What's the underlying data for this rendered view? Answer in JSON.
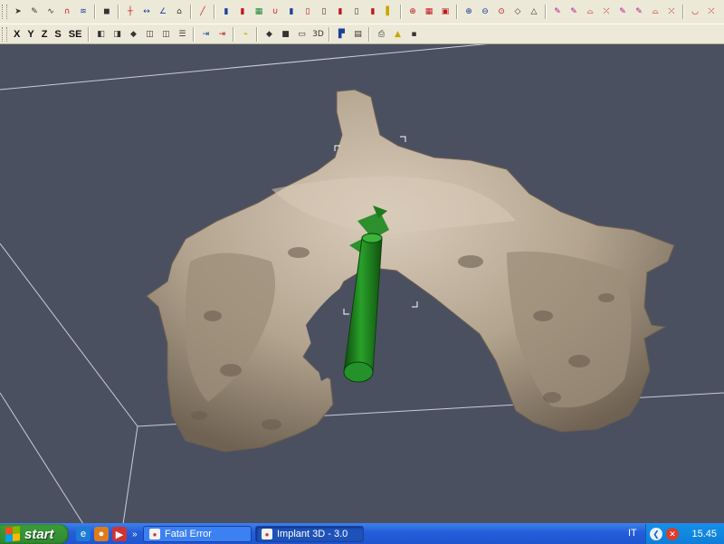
{
  "toolbar": {
    "row1": [
      {
        "name": "select-arrow-icon",
        "glyph": "➤",
        "cls": "c-dk"
      },
      {
        "name": "draw-pen-icon",
        "glyph": "✎",
        "cls": "c-dk"
      },
      {
        "name": "curve-icon",
        "glyph": "∿",
        "cls": "c-dk"
      },
      {
        "name": "arc-icon",
        "glyph": "∩",
        "cls": "c-red"
      },
      {
        "name": "spiral-icon",
        "glyph": "≋",
        "cls": "c-blue"
      },
      {
        "sep": true
      },
      {
        "name": "cube-view-icon",
        "glyph": "◼",
        "cls": "c-dk"
      },
      {
        "sep": true
      },
      {
        "name": "crosshair-icon",
        "glyph": "┼",
        "cls": "c-red"
      },
      {
        "name": "measure-distance-icon",
        "glyph": "↔",
        "cls": "c-blue"
      },
      {
        "name": "angle-icon",
        "glyph": "∠",
        "cls": "c-blue"
      },
      {
        "name": "house-section-icon",
        "glyph": "⌂",
        "cls": "c-dk"
      },
      {
        "sep": true
      },
      {
        "name": "wand-icon",
        "glyph": "╱",
        "cls": "c-red"
      },
      {
        "sep": true
      },
      {
        "name": "implant-add-icon",
        "glyph": "▮",
        "cls": "c-blue"
      },
      {
        "name": "implant-remove-icon",
        "glyph": "▮",
        "cls": "c-red"
      },
      {
        "name": "implant-group-icon",
        "glyph": "▦",
        "cls": "c-green"
      },
      {
        "name": "magnet-icon",
        "glyph": "∪",
        "cls": "c-red"
      },
      {
        "name": "implant-tilt-icon",
        "glyph": "▮",
        "cls": "c-blue"
      },
      {
        "name": "implant-a-icon",
        "glyph": "▯",
        "cls": "c-red"
      },
      {
        "name": "implant-b-icon",
        "glyph": "▯",
        "cls": "c-dk"
      },
      {
        "name": "implant-c-icon",
        "glyph": "▮",
        "cls": "c-red"
      },
      {
        "name": "implant-d-icon",
        "glyph": "▯",
        "cls": "c-dk"
      },
      {
        "name": "implant-e-icon",
        "glyph": "▮",
        "cls": "c-red"
      },
      {
        "name": "light-icon",
        "glyph": "▌",
        "cls": "c-yel"
      },
      {
        "sep": true
      },
      {
        "name": "view-target-icon",
        "glyph": "⊕",
        "cls": "c-red"
      },
      {
        "name": "view-grid-icon",
        "glyph": "▦",
        "cls": "c-red"
      },
      {
        "name": "view-box-icon",
        "glyph": "▣",
        "cls": "c-red"
      },
      {
        "sep": true
      },
      {
        "name": "zoom-in-icon",
        "glyph": "⊕",
        "cls": "c-blue"
      },
      {
        "name": "zoom-out-icon",
        "glyph": "⊖",
        "cls": "c-blue"
      },
      {
        "name": "zoom-fit-icon",
        "glyph": "⊙",
        "cls": "c-red"
      },
      {
        "name": "rotate-icon",
        "glyph": "◇",
        "cls": "c-dk"
      },
      {
        "name": "pan-icon",
        "glyph": "△",
        "cls": "c-dk"
      },
      {
        "sep": true
      },
      {
        "name": "show-mandible-icon",
        "glyph": "✎",
        "cls": "c-mag"
      },
      {
        "name": "show-maxilla-icon",
        "glyph": "✎",
        "cls": "c-mag"
      },
      {
        "name": "show-nerve-icon",
        "glyph": "⌓",
        "cls": "c-red"
      },
      {
        "name": "hide-nerve-icon",
        "glyph": "⤫",
        "cls": "c-red"
      },
      {
        "name": "show-teeth-icon",
        "glyph": "✎",
        "cls": "c-mag"
      },
      {
        "name": "show-guide-icon",
        "glyph": "✎",
        "cls": "c-mag"
      },
      {
        "name": "show-contour-icon",
        "glyph": "⌓",
        "cls": "c-red"
      },
      {
        "name": "hide-contour-icon",
        "glyph": "⤫",
        "cls": "c-red"
      },
      {
        "sep": true
      },
      {
        "name": "show-bone-icon",
        "glyph": "◡",
        "cls": "c-red"
      },
      {
        "name": "hide-bone-icon",
        "glyph": "⤫",
        "cls": "c-red"
      }
    ],
    "row2": [
      {
        "name": "axis-x-button",
        "text": "X"
      },
      {
        "name": "axis-y-button",
        "text": "Y"
      },
      {
        "name": "axis-z-button",
        "text": "Z"
      },
      {
        "name": "axis-s-button",
        "text": "S"
      },
      {
        "name": "axis-se-button",
        "text": "SE"
      },
      {
        "sep": true
      },
      {
        "name": "slice-a-icon",
        "glyph": "◧",
        "cls": "c-dk"
      },
      {
        "name": "slice-b-icon",
        "glyph": "◨",
        "cls": "c-dk"
      },
      {
        "name": "slice-c-icon",
        "glyph": "◆",
        "cls": "c-dk"
      },
      {
        "name": "slice-d-icon",
        "glyph": "◫",
        "cls": "c-dk"
      },
      {
        "name": "slice-e-icon",
        "glyph": "◫",
        "cls": "c-dk"
      },
      {
        "name": "slice-f-icon",
        "glyph": "☰",
        "cls": "c-dk"
      },
      {
        "sep": true
      },
      {
        "name": "export-icon",
        "glyph": "⇥",
        "cls": "c-blue"
      },
      {
        "name": "export-red-icon",
        "glyph": "⇥",
        "cls": "c-red"
      },
      {
        "sep": true
      },
      {
        "name": "scan-icon",
        "glyph": "⌁",
        "cls": "c-yel"
      },
      {
        "sep": true
      },
      {
        "name": "shape-diamond-icon",
        "glyph": "◆",
        "cls": "c-dk"
      },
      {
        "name": "shape-square-icon",
        "glyph": "■",
        "cls": "c-dk"
      },
      {
        "name": "shape-rect-icon",
        "glyph": "▭",
        "cls": "c-dk"
      },
      {
        "name": "view-3d-icon",
        "glyph": "3D",
        "cls": "c-dk"
      },
      {
        "sep": true
      },
      {
        "name": "layout-icon",
        "glyph": "▛",
        "cls": "c-blue"
      },
      {
        "name": "panel-icon",
        "glyph": "▤",
        "cls": "c-dk"
      },
      {
        "sep": true
      },
      {
        "name": "print-icon",
        "glyph": "⎙",
        "cls": "c-dk"
      },
      {
        "name": "warning-icon",
        "glyph": "▲",
        "cls": "c-yel"
      },
      {
        "name": "save-icon",
        "glyph": "▪",
        "cls": "c-dk"
      }
    ]
  },
  "taskbar": {
    "start_label": "start",
    "quicklaunch": [
      {
        "name": "ie-icon",
        "glyph": "e",
        "color": "#1e7bd6"
      },
      {
        "name": "firefox-icon",
        "glyph": "●",
        "color": "#e07b1b"
      },
      {
        "name": "media-icon",
        "glyph": "▶",
        "color": "#cf3434"
      }
    ],
    "more": "»",
    "tasks": [
      {
        "name": "task-fatal-error",
        "label": "Fatal Error",
        "active": false
      },
      {
        "name": "task-implant-3d",
        "label": "Implant 3D - 3.0",
        "active": true
      }
    ],
    "language": "IT",
    "clock": "15.45"
  },
  "colors": {
    "background": "#4b5060",
    "bone": "#b7a894",
    "implant": "#1e7a1e"
  }
}
